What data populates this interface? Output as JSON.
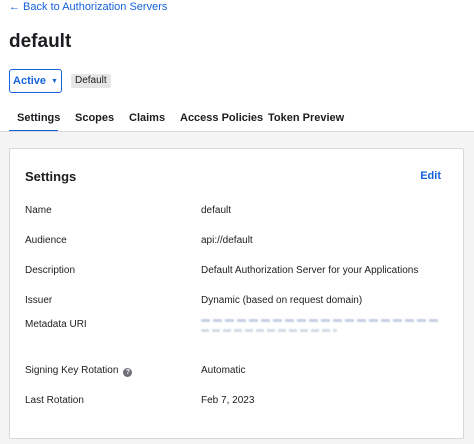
{
  "back_link": "← Back to Authorization Servers",
  "page_title": "default",
  "status": {
    "label": "Active"
  },
  "badge": "Default",
  "tabs": [
    {
      "label": "Settings"
    },
    {
      "label": "Scopes"
    },
    {
      "label": "Claims"
    },
    {
      "label": "Access Policies"
    },
    {
      "label": "Token Preview"
    }
  ],
  "settings": {
    "title": "Settings",
    "edit_label": "Edit",
    "rows": [
      {
        "label": "Name",
        "value": "default"
      },
      {
        "label": "Audience",
        "value": "api://default"
      },
      {
        "label": "Description",
        "value": "Default Authorization Server for your Applications"
      },
      {
        "label": "Issuer",
        "value": "Dynamic (based on request domain)"
      },
      {
        "label": "Metadata URI",
        "value": ""
      },
      {
        "label": "Signing Key Rotation",
        "value": "Automatic"
      },
      {
        "label": "Last Rotation",
        "value": "Feb 7, 2023"
      }
    ]
  },
  "colors": {
    "accent": "#1662dd",
    "text": "#1d1d21",
    "border": "#d7d7dc",
    "panel": "#f4f4f4"
  }
}
